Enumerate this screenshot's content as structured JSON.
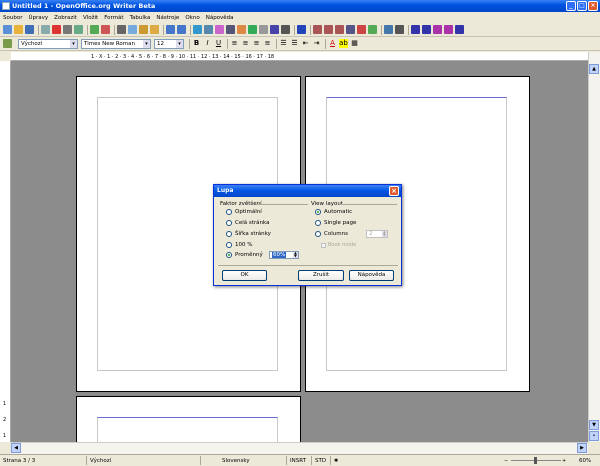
{
  "window": {
    "title": "Untitled 1 - OpenOffice.org Writer Beta"
  },
  "menu": [
    "Soubor",
    "Úpravy",
    "Zobrazit",
    "Vložit",
    "Formát",
    "Tabulka",
    "Nástroje",
    "Okno",
    "Nápověda"
  ],
  "format_toolbar": {
    "style": "Výchozí",
    "font": "Times New Roman",
    "size": "12"
  },
  "ruler": {
    "numbers": "1 · X · 1 · 2 · 3 · 4 · 5 · 6 · 7 · 8 · 9 · 10 · 11 · 12 · 13 · 14 · 15 · 16 · 17 · 18"
  },
  "vruler": [
    "1",
    "2",
    "1"
  ],
  "dialog": {
    "title": "Lupa",
    "zoom_group": "Faktor zvětšení",
    "zoom_options": [
      "Optimální",
      "Celá stránka",
      "Šířka stránky",
      "100 %",
      "Proměnný"
    ],
    "zoom_selected": "Proměnný",
    "zoom_value": "60%",
    "view_group": "View layout",
    "view_options": [
      "Automatic",
      "Single page",
      "Columns"
    ],
    "view_selected": "Automatic",
    "columns_value": "2",
    "book_mode": "Book mode",
    "buttons": {
      "ok": "OK",
      "cancel": "Zrušit",
      "help": "Nápověda"
    }
  },
  "status": {
    "page": "Strana 3 / 3",
    "style": "Výchozí",
    "language": "Slovensky",
    "insert": "INSRT",
    "selection": "STD",
    "zoom": "60%"
  },
  "colors": {
    "title_bar": "#0054e3",
    "document_bg": "#8c8c8c",
    "dialog_border": "#0831d9"
  }
}
